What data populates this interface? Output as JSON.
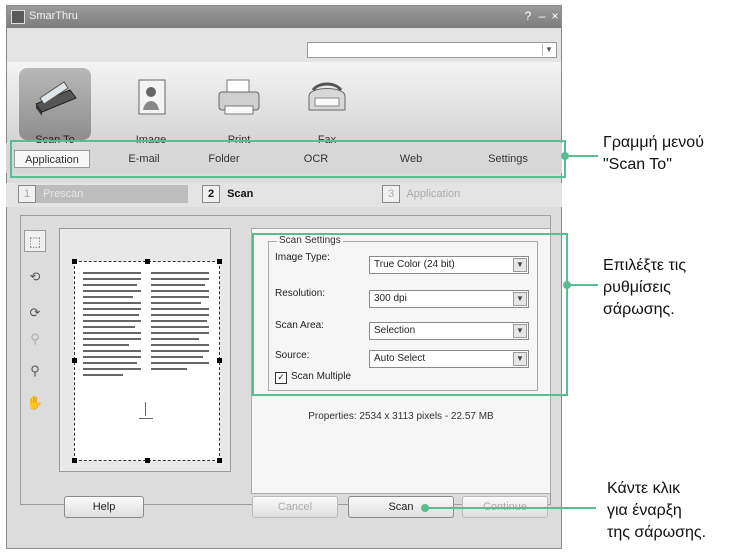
{
  "window": {
    "title": "SmarThru",
    "help_icon": "?",
    "minimize_icon": "–",
    "close_icon": "×"
  },
  "toolbar": {
    "items": [
      {
        "label": "Scan To",
        "icon": "scanner-icon"
      },
      {
        "label": "Image",
        "icon": "image-icon"
      },
      {
        "label": "Print",
        "icon": "printer-icon"
      },
      {
        "label": "Fax",
        "icon": "fax-icon"
      }
    ]
  },
  "menu": {
    "items": [
      "Application",
      "E-mail",
      "Folder",
      "OCR",
      "Web",
      "Settings"
    ],
    "selected": "Application"
  },
  "steps": [
    {
      "num": "1",
      "label": "Prescan"
    },
    {
      "num": "2",
      "label": "Scan"
    },
    {
      "num": "3",
      "label": "Application"
    }
  ],
  "scan_settings": {
    "title": "Scan Settings",
    "image_type_label": "Image Type:",
    "image_type_value": "True Color (24 bit)",
    "resolution_label": "Resolution:",
    "resolution_value": "300 dpi",
    "scan_area_label": "Scan Area:",
    "scan_area_value": "Selection",
    "source_label": "Source:",
    "source_value": "Auto Select",
    "scan_multiple_label": "Scan Multiple",
    "scan_multiple_checked": true
  },
  "properties": "Properties: 2534 x 3113 pixels - 22.57 MB",
  "buttons": {
    "help": "Help",
    "cancel": "Cancel",
    "scan": "Scan",
    "continue": "Continue"
  },
  "callouts": {
    "menu_1": "Γραμμή μενού",
    "menu_2": "\"Scan To\"",
    "settings_1": "Επιλέξτε τις",
    "settings_2": "ρυθμίσεις",
    "settings_3": "σάρωσης.",
    "scan_1": "Κάντε κλικ",
    "scan_2": "για έναρξη",
    "scan_3": "της σάρωσης."
  },
  "colors": {
    "highlight": "#5bbd8f"
  }
}
